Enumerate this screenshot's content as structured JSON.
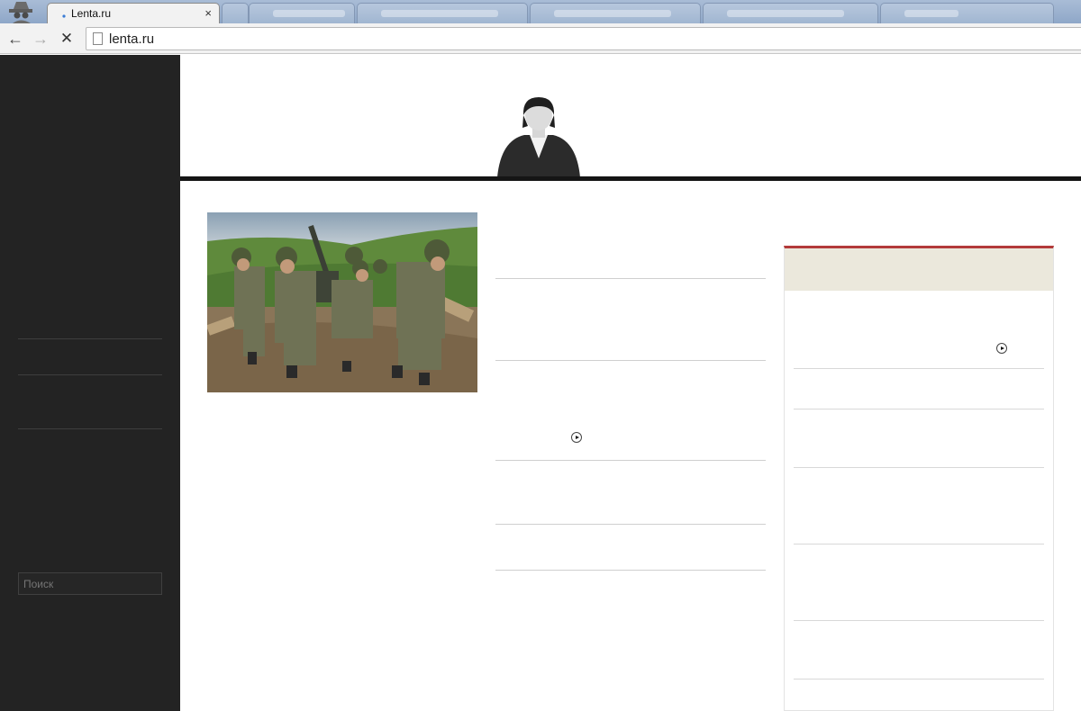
{
  "browser": {
    "active_tab": {
      "title": "Lenta.ru",
      "close_label": "×"
    },
    "url": "lenta.ru",
    "nav": {
      "back": "←",
      "forward": "→",
      "stop": "✕"
    }
  },
  "sidebar": {
    "search": {
      "placeholder": "Поиск"
    }
  },
  "colors": {
    "sidebar_bg": "#232323",
    "header_bar": "#151515",
    "widget_accent": "#b33a3a",
    "widget_header_bg": "#ebe8dc"
  }
}
